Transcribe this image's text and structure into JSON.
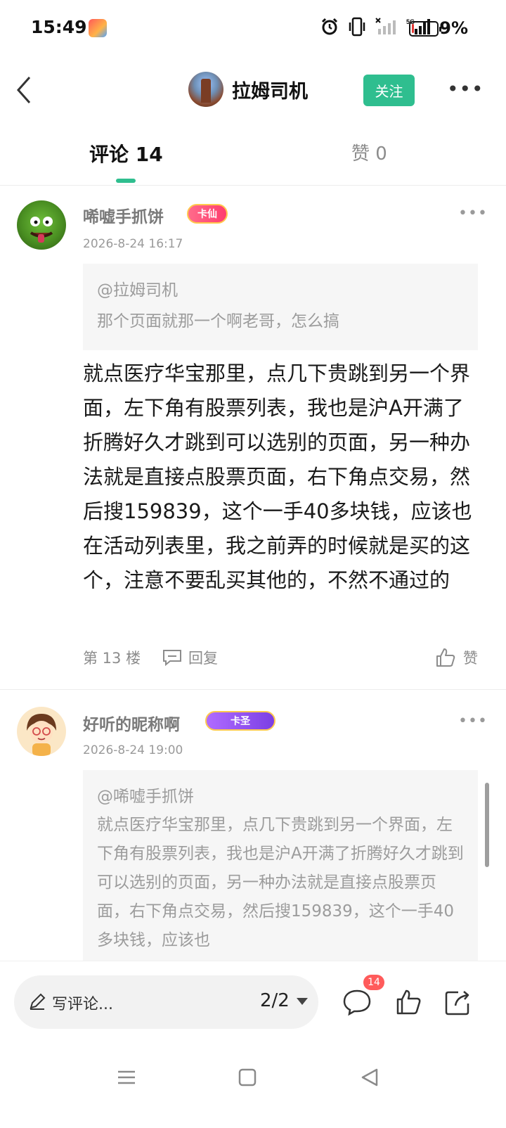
{
  "status_bar": {
    "time": "15:49",
    "battery_percent": "9%",
    "battery_level": 0.09,
    "icons": [
      "app-notification-icon",
      "alarm-icon",
      "vibrate-icon",
      "signal-icon",
      "5g-signal-icon",
      "battery-icon"
    ]
  },
  "header": {
    "author_name": "拉姆司机",
    "follow_label": "关注"
  },
  "tabs": {
    "comments_label": "评论 14",
    "likes_label": "赞 0"
  },
  "comments": [
    {
      "username": "唏嘘手抓饼",
      "badge": "卡仙",
      "time": "2026-8-24 16:17",
      "quote_at": "@拉姆司机",
      "quote_text": "那个页面就那一个啊老哥，怎么搞",
      "body": "就点医疗华宝那里，点几下贵跳到另一个界面，左下角有股票列表，我也是沪A开满了折腾好久才跳到可以选别的页面，另一种办法就是直接点股票页面，右下角点交易，然后搜159839，这个一手40多块钱，应该也在活动列表里，我之前弄的时候就是买的这个，注意不要乱买其他的，不然不通过的",
      "floor": "第 13 楼",
      "reply_label": "回复",
      "like_label": "赞"
    },
    {
      "username": "好听的昵称啊",
      "badge": "卡圣",
      "time": "2026-8-24 19:00",
      "quote_at": "@唏嘘手抓饼",
      "quote_text": "就点医疗华宝那里，点几下贵跳到另一个界面，左下角有股票列表，我也是沪A开满了折腾好久才跳到可以选别的页面，另一种办法就是直接点股票页面，右下角点交易，然后搜159839，这个一手40多块钱，应该也"
    }
  ],
  "bottom_bar": {
    "write_placeholder": "写评论...",
    "page_indicator": "2/2",
    "comment_count": "14"
  },
  "colors": {
    "accent": "#2fbe8f",
    "badge_red": "#ff5b5b",
    "muted_text": "#9c9c9c"
  }
}
